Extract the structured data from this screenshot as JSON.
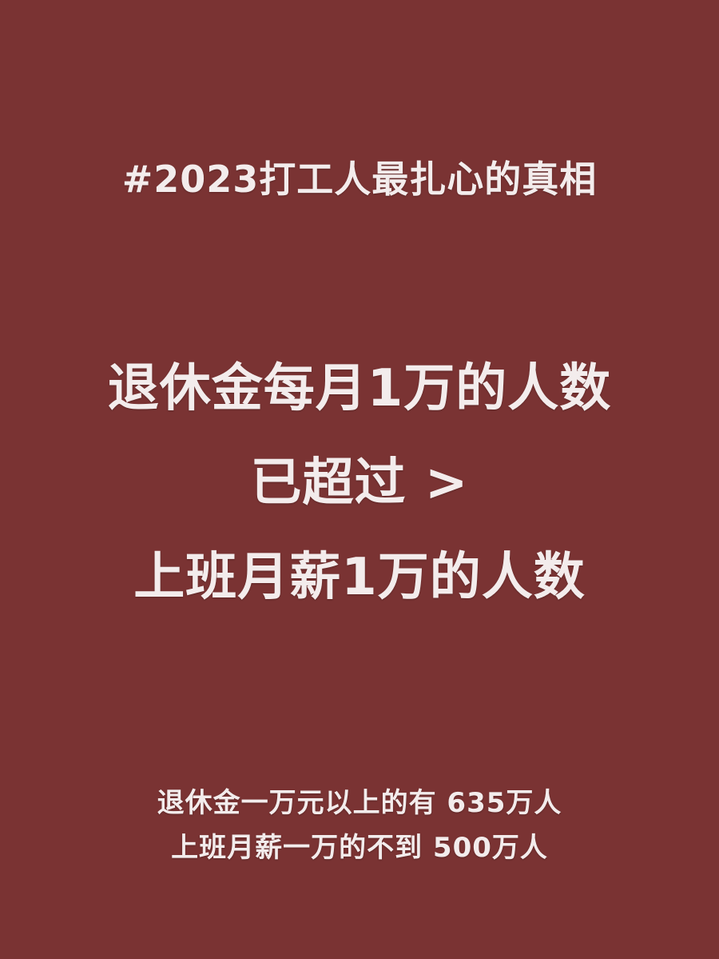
{
  "colors": {
    "background": "#7a3333",
    "text": "#f3ecec"
  },
  "hashtag_title": "#2023打工人最扎心的真相",
  "headline": {
    "line1": "退休金每月1万的人数",
    "line2": "已超过 >",
    "line3": "上班月薪1万的人数"
  },
  "facts": [
    "退休金一万元以上的有 635万人",
    "上班月薪一万的不到 500万人"
  ]
}
